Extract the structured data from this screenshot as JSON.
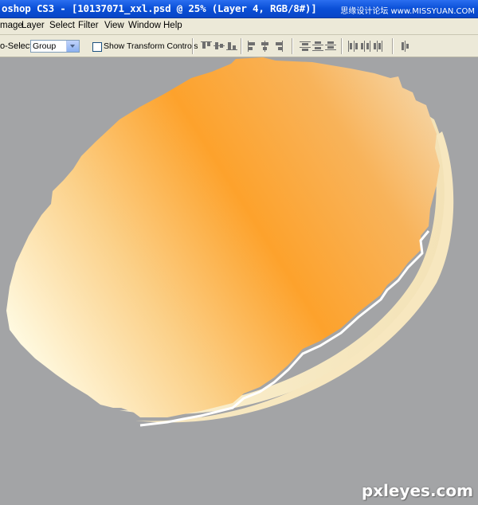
{
  "window": {
    "title": "oshop CS3 - [10137071_xxl.psd @ 25% (Layer 4, RGB/8#)]",
    "watermark": "思缘设计论坛 www.MISSYUAN.COM"
  },
  "menu": {
    "items": [
      "mage",
      "Layer",
      "Select",
      "Filter",
      "View",
      "Window",
      "Help"
    ]
  },
  "options": {
    "auto_select_label": "o-Select:",
    "auto_select_value": "Group",
    "show_transform_label": "Show Transform Controls",
    "show_transform_checked": false
  },
  "canvas": {
    "background_color": "#a3a4a6",
    "shape_gradient": [
      "#fffbe4",
      "#fbd18a",
      "#fda22c",
      "#f8b35a",
      "#f6d6a7"
    ],
    "edge_color": "#f7e7bf"
  },
  "credit": "pxleyes.com"
}
